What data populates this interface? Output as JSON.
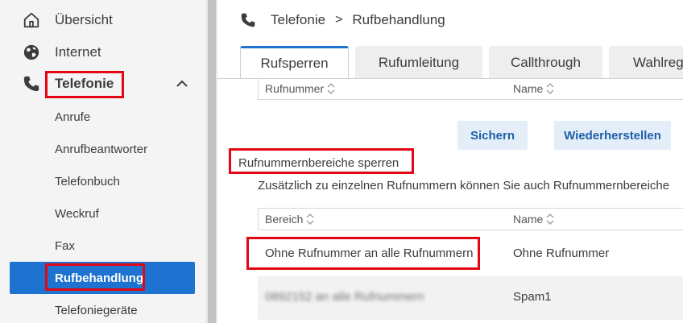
{
  "sidebar": {
    "items": [
      {
        "label": "Übersicht",
        "icon": "home-icon"
      },
      {
        "label": "Internet",
        "icon": "globe-icon"
      },
      {
        "label": "Telefonie",
        "icon": "phone-icon"
      }
    ],
    "subitems": [
      {
        "label": "Anrufe"
      },
      {
        "label": "Anrufbeantworter"
      },
      {
        "label": "Telefonbuch"
      },
      {
        "label": "Weckruf"
      },
      {
        "label": "Fax"
      },
      {
        "label": "Rufbehandlung",
        "active": true
      },
      {
        "label": "Telefoniegeräte"
      }
    ]
  },
  "header": {
    "breadcrumb": {
      "section": "Telefonie",
      "separator": ">",
      "page": "Rufbehandlung"
    },
    "tabs": [
      {
        "label": "Rufsperren",
        "active": true
      },
      {
        "label": "Rufumleitung"
      },
      {
        "label": "Callthrough"
      },
      {
        "label": "Wahlrege"
      }
    ]
  },
  "table_top": {
    "col1": "Rufnummer",
    "col2": "Name"
  },
  "buttons": {
    "save": "Sichern",
    "restore": "Wiederherstellen"
  },
  "range_section": {
    "title": "Rufnummernbereiche sperren",
    "description": "Zusätzlich zu einzelnen Rufnummern können Sie auch Rufnummernbereiche",
    "col1": "Bereich",
    "col2": "Name",
    "rows": [
      {
        "range": "Ohne Rufnummer an alle Rufnummern",
        "name": "Ohne Rufnummer"
      },
      {
        "range": "0892152 an alle Rufnummern",
        "name": "Spam1"
      }
    ]
  },
  "colors": {
    "accent": "#1d73cf",
    "highlight": "#e30613",
    "button_bg": "#e4eef8"
  }
}
